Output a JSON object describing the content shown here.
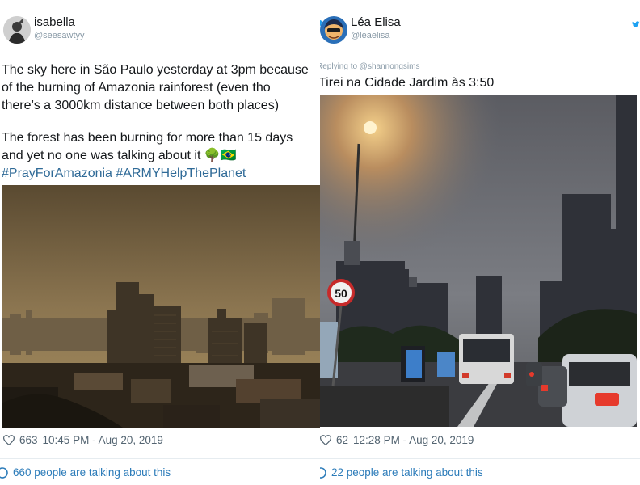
{
  "tweets": [
    {
      "name": "isabella",
      "handle": "@seesawtyy",
      "lines": [
        "The sky here in São Paulo yesterday at 3pm because",
        "of the burning of Amazonia rainforest (even tho",
        "there’s a 3000km distance between both places)",
        "",
        "The forest has been burning for more than 15 days",
        "and yet no one was talking about it"
      ],
      "emoji": "🌳🇧🇷",
      "hashtags": "#PrayForAmazonia #ARMYHelpThePlanet",
      "likes": "663",
      "timestamp": "10:45 PM - Aug 20, 2019",
      "talking": "660 people are talking about this"
    },
    {
      "name": "Léa Elisa",
      "handle": "@leaelisa",
      "replying_to": "Replying to @shannongsims",
      "text": "Tirei na Cidade Jardim às 3:50",
      "likes": "62",
      "timestamp": "12:28 PM - Aug 20, 2019",
      "talking": "22 people are talking about this",
      "speed_sign": "50"
    }
  ],
  "colors": {
    "link": "#2b7bb9",
    "hashtag": "#2f6a97",
    "meta": "#536471",
    "twitter_blue": "#1da1f2"
  }
}
